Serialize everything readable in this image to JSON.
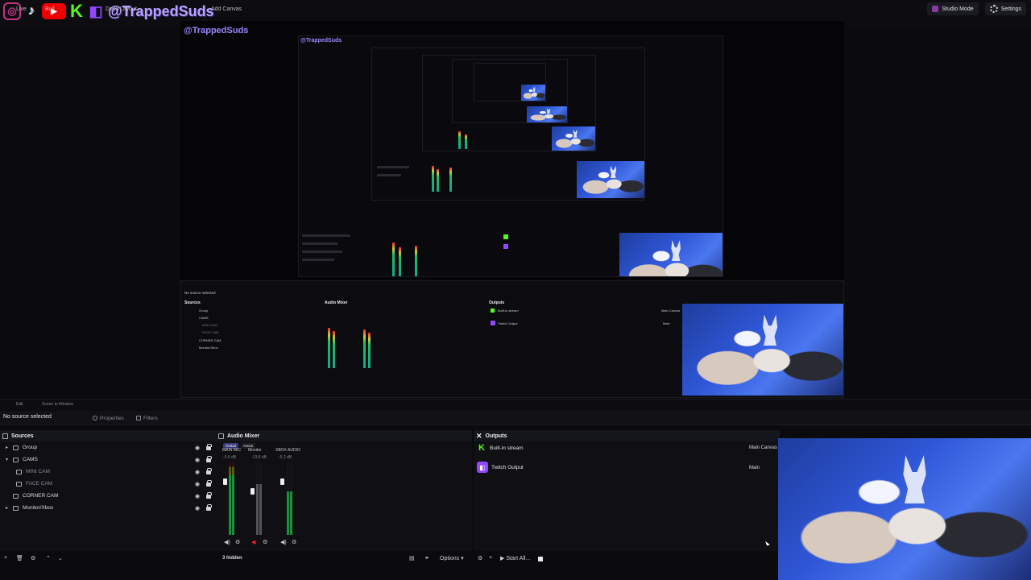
{
  "topbar": {
    "handle": "@TrappedSuds",
    "mini_labels": [
      "Live",
      "Buil",
      "Dock Layout",
      "Add Canvas"
    ],
    "studio_mode_label": "Studio Mode",
    "settings_label": "Settings",
    "icons": [
      "instagram-icon",
      "tiktok-icon",
      "youtube-icon",
      "kick-icon",
      "twitch-icon"
    ]
  },
  "preview": {
    "nested_handle": "@TrappedSuds",
    "nested_sources_labels": [
      "Group",
      "CAMS",
      "MINI CAM",
      "FACE CAM",
      "CORNER CAM",
      "Monitor/Xbox"
    ],
    "nested_outputs": [
      "Built-in stream",
      "Twitch Output"
    ],
    "nested_right": [
      "Main Canvas",
      "Main"
    ],
    "nested_props": [
      "No source selected",
      "Properties",
      "Filters"
    ]
  },
  "strip": {
    "labels": [
      "Edit",
      "Scene to Window"
    ]
  },
  "properties_bar": {
    "no_source": "No source selected",
    "properties": "Properties",
    "filters": "Filters"
  },
  "sources": {
    "title": "Sources",
    "items": [
      {
        "label": "Group",
        "indent": 0,
        "arrow": "▸",
        "dim": false
      },
      {
        "label": "CAMS",
        "indent": 0,
        "arrow": "▾",
        "dim": false
      },
      {
        "label": "MINI CAM",
        "indent": 1,
        "arrow": "",
        "dim": true
      },
      {
        "label": "FACE CAM",
        "indent": 1,
        "arrow": "",
        "dim": true
      },
      {
        "label": "CORNER CAM",
        "indent": 0,
        "arrow": "",
        "dim": false
      },
      {
        "label": "Monitor/Xbox",
        "indent": 0,
        "arrow": "▸",
        "dim": false
      }
    ]
  },
  "audio_mixer": {
    "title": "Audio Mixer",
    "tabs": [
      "Global",
      "Active"
    ],
    "channels": [
      {
        "name": "MAIN MIC",
        "db": "-5.6 dB",
        "tab": "Global"
      },
      {
        "name": "Monitor",
        "db": "-13.8 dB",
        "tab": "Active"
      },
      {
        "name": "XBOX AUDIO",
        "db": "-5.2 dB",
        "tab": "Active"
      }
    ],
    "hidden_count": "3 hidden",
    "options_label": "Options"
  },
  "outputs": {
    "title": "Outputs",
    "items": [
      {
        "label": "Built-in stream",
        "canvas": "Main Canvas",
        "icon": "kick-icon"
      },
      {
        "label": "Twitch Output",
        "canvas": "Main",
        "icon": "twitch-icon"
      }
    ],
    "start_all_label": "Start All..."
  },
  "colors": {
    "kick": "#53fc18",
    "twitch": "#9146ff",
    "youtube": "#ee0000",
    "accent": "#3a3a7a"
  }
}
